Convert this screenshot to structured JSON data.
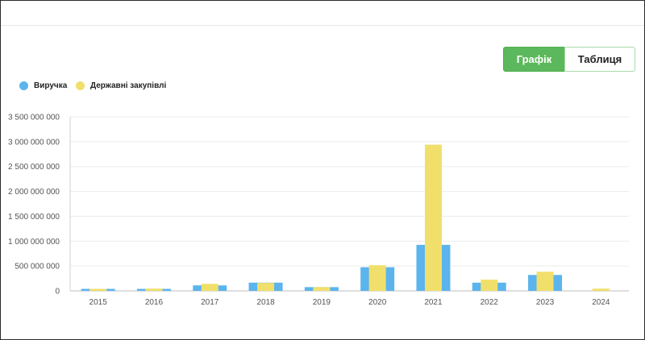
{
  "view_toggle": {
    "chart_label": "Графік",
    "table_label": "Таблиця"
  },
  "colors": {
    "revenue": "#5bb4ee",
    "procurement": "#f1df6b",
    "active_toggle": "#5cb85c"
  },
  "chart_data": {
    "type": "bar",
    "categories": [
      "2015",
      "2016",
      "2017",
      "2018",
      "2019",
      "2020",
      "2021",
      "2022",
      "2023",
      "2024"
    ],
    "series": [
      {
        "name": "Виручка",
        "values": [
          40000000,
          40000000,
          110000000,
          165000000,
          75000000,
          475000000,
          925000000,
          165000000,
          320000000,
          null
        ]
      },
      {
        "name": "Державні закупівлі",
        "values": [
          40000000,
          45000000,
          140000000,
          160000000,
          75000000,
          515000000,
          2940000000,
          225000000,
          385000000,
          45000000
        ]
      }
    ],
    "yticks": [
      "0",
      "500 000 000",
      "1 000 000 000",
      "1 500 000 000",
      "2 000 000 000",
      "2 500 000 000",
      "3 000 000 000",
      "3 500 000 000"
    ],
    "ylim": [
      0,
      3500000000
    ],
    "grid": true,
    "legend_position": "top-left"
  }
}
